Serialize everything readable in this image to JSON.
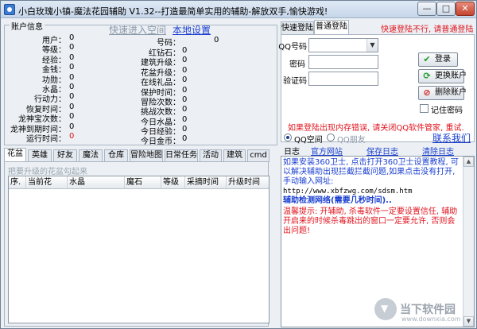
{
  "titlebar": {
    "title": "小白玫瑰小镇-魔法花园辅助 V1.32--打造最简单实用的辅助-解放双手,愉快游戏!",
    "min": "—",
    "max": "□",
    "close": "✕"
  },
  "account": {
    "group_title": "账户信息",
    "quick_login_link": "快速进入空间",
    "local_settings_link": "本地设置",
    "left_fields": [
      {
        "label": "用户：",
        "value": "0"
      },
      {
        "label": "等级：",
        "value": "0"
      },
      {
        "label": "经验：",
        "value": "0"
      },
      {
        "label": "金钱：",
        "value": "0"
      },
      {
        "label": "功勋：",
        "value": "0"
      },
      {
        "label": "水晶：",
        "value": "0"
      },
      {
        "label": "行动力：",
        "value": "0"
      },
      {
        "label": "恢复时间：",
        "value": "0"
      },
      {
        "label": "龙神宝次数：",
        "value": "0"
      },
      {
        "label": "龙神到期时间：",
        "value": "0"
      },
      {
        "label": "运行时间：",
        "value": "0"
      }
    ],
    "mid_fields": [
      {
        "label": "号码：",
        "value": "0"
      },
      {
        "label": "红钻石：",
        "value": "0"
      },
      {
        "label": "建筑升级：",
        "value": "0"
      },
      {
        "label": "花盆升级：",
        "value": "0"
      },
      {
        "label": "在线礼品：",
        "value": "0"
      },
      {
        "label": "保护时间：",
        "value": "0"
      },
      {
        "label": "冒险次数：",
        "value": "0"
      },
      {
        "label": "挑战次数：",
        "value": "0"
      },
      {
        "label": "今日水晶：",
        "value": "0"
      },
      {
        "label": "今日经验：",
        "value": "0"
      },
      {
        "label": "今日金币：",
        "value": "0"
      }
    ]
  },
  "tabs": [
    "花盆",
    "英雄",
    "好友",
    "魔法",
    "仓库",
    "冒险地图",
    "日常任务",
    "活动",
    "建筑",
    "cmd"
  ],
  "flowerpot": {
    "hint": "把要升级的花盆勾起来",
    "columns": [
      "序.",
      "当前花",
      "水晶",
      "魔石",
      "等级",
      "采摘时间",
      "升级时间"
    ]
  },
  "login": {
    "tabs": [
      "快速登陆",
      "普通登陆"
    ],
    "notice": "快速登陆不行, 请普通登陆",
    "qq_label": "QQ号码",
    "pwd_label": "密码",
    "captcha_label": "验证码",
    "login_btn": "登录",
    "switch_btn": "更换账户",
    "delete_btn": "删除账户",
    "remember": "记住密码",
    "error_tip": "如果登陆出现内存错误, 请关闭QQ软件管家, 重试."
  },
  "log_area": {
    "radio_space": "QQ空间",
    "radio_friend": "QQ朋友",
    "contact_link": "联系我们",
    "log_label": "日志",
    "official_site": "官方网站",
    "save_log": "保存日志",
    "clear_log": "清除日志",
    "lines": [
      {
        "text": "如果安装360卫士, 点击打开360卫士设置教程, 可以解决辅助出现拦截拦截问题,如果点击没有打开, 手动输入网址:",
        "color": "#1a3fd0"
      },
      {
        "text": "http://www.xbfzwg.com/sdsm.htm",
        "color": "#000000"
      },
      {
        "text": "辅助检测网络(需要几秒时间)..",
        "color": "#1a3fd0"
      },
      {
        "text": "温馨提示: 开辅助, 杀毒软件一定要设置信任, 辅助开启来的时候杀毒跳出的窗口一定要允许, 否则会出问题!",
        "color": "#e0141e"
      }
    ]
  },
  "watermark": {
    "text": "当下软件园",
    "sub": "www.downxia.com"
  }
}
